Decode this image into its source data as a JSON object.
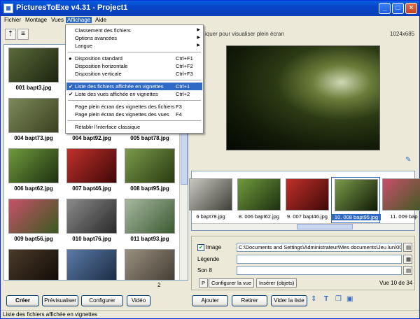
{
  "window": {
    "title": "PicturesToExe v4.31 - Project1"
  },
  "menubar": [
    "Fichier",
    "Montage",
    "Vues",
    "Affichage",
    "Aide"
  ],
  "dropdown": [
    {
      "label": "Classement des fichiers",
      "shortcut": "",
      "submenu": true,
      "mark": ""
    },
    {
      "label": "Options avancées",
      "shortcut": "",
      "submenu": true,
      "mark": ""
    },
    {
      "label": "Langue",
      "shortcut": "",
      "submenu": true,
      "mark": ""
    },
    {
      "label": "Disposition standard",
      "shortcut": "Ctrl+F1",
      "submenu": false,
      "mark": "●"
    },
    {
      "label": "Disposition horizontale",
      "shortcut": "Ctrl+F2",
      "submenu": false,
      "mark": ""
    },
    {
      "label": "Disposition verticale",
      "shortcut": "Ctrl+F3",
      "submenu": false,
      "mark": ""
    },
    {
      "label": "Liste des fichiers affichée en vignettes",
      "shortcut": "Ctrl+1",
      "submenu": false,
      "mark": "✔",
      "highlighted": true
    },
    {
      "label": "Liste des vues affichée en vignettes",
      "shortcut": "Ctrl+2",
      "submenu": false,
      "mark": "✔"
    },
    {
      "label": "Page plein écran des vignettes des fichiers",
      "shortcut": "F3",
      "submenu": false,
      "mark": ""
    },
    {
      "label": "Page plein écran des vignettes des vues",
      "shortcut": "F4",
      "submenu": false,
      "mark": ""
    },
    {
      "label": "Rétablir l'interface classique",
      "shortcut": "",
      "submenu": false,
      "mark": ""
    }
  ],
  "thumbnails": [
    {
      "label": "001 bapt3.jpg",
      "c1": "#5a6b3a",
      "c2": "#1c2410"
    },
    {
      "label": "",
      "c1": "#5d7a34",
      "c2": "#2a3a14"
    },
    {
      "label": "",
      "c1": "#4a6a2c",
      "c2": "#203010"
    },
    {
      "label": "004 bapt73.jpg",
      "c1": "#7d8a5a",
      "c2": "#3a4020"
    },
    {
      "label": "004 bapt92.jpg",
      "c1": "#8a6a2a",
      "c2": "#2a1a08"
    },
    {
      "label": "005 bapt78.jpg",
      "c1": "#6a8a3a",
      "c2": "#2c4014"
    },
    {
      "label": "006 bapt62.jpg",
      "c1": "#6e9a3c",
      "c2": "#1e3010"
    },
    {
      "label": "007 bapt46.jpg",
      "c1": "#c0302a",
      "c2": "#400808"
    },
    {
      "label": "008 bapt95.jpg",
      "c1": "#7a9a4a",
      "c2": "#2a3a10"
    },
    {
      "label": "009 bapt56.jpg",
      "c1": "#c8506a",
      "c2": "#3a5a20"
    },
    {
      "label": "010 bapt76.jpg",
      "c1": "#8a8a8a",
      "c2": "#2a2a2a"
    },
    {
      "label": "011 bapt93.jpg",
      "c1": "#a8b8a0",
      "c2": "#3a5a30"
    },
    {
      "label": "",
      "c1": "#4a3a2a",
      "c2": "#100a05"
    },
    {
      "label": "",
      "c1": "#5a7aa8",
      "c2": "#1a2a40"
    },
    {
      "label": "",
      "c1": "#9a9080",
      "c2": "#403a30"
    }
  ],
  "preview": {
    "hint": "iquer pour visualiser plein écran",
    "resolution": "1024x685"
  },
  "strip": [
    {
      "label": "6 bapt78.jpg",
      "c1": "#c8c8c0",
      "c2": "#404038"
    },
    {
      "label": "8. 006 bapt62.jpg",
      "c1": "#6e9a3c",
      "c2": "#1e3010"
    },
    {
      "label": "9. 007 bapt46.jpg",
      "c1": "#c0302a",
      "c2": "#400808"
    },
    {
      "label": "10. 008 bapt95.jpg",
      "c1": "#7a9a4a",
      "c2": "#101a05",
      "selected": true
    },
    {
      "label": "11. 009 bap",
      "c1": "#c8506a",
      "c2": "#3a5a20"
    }
  ],
  "props": {
    "image_label": "Image",
    "image_path": "C:\\Documents and Settings\\Administrateur\\Mes documents\\Jeu lun\\008",
    "legende_label": "Légende",
    "son_label": "Son 8",
    "p_btn": "P",
    "config_btn": "Configurer la vue",
    "insert_btn": "Insérer (objets)",
    "counter": "Vue 10 de 34"
  },
  "left_count": "2",
  "bottom_left": [
    "Créer",
    "Prévisualiser",
    "Configurer",
    "Vidéo"
  ],
  "bottom_right": [
    "Ajouter",
    "Retirer",
    "Vider la liste"
  ],
  "status": "Liste des fichiers affichée en vignettes"
}
